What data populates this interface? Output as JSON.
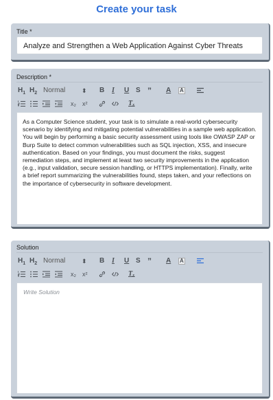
{
  "page": {
    "title": "Create your task"
  },
  "title_field": {
    "label": "Title *",
    "value": "Analyze and Strengthen a Web Application Against Cyber Threats"
  },
  "description": {
    "label": "Description *",
    "text": "As a Computer Science student, your task is to simulate a real-world cybersecurity scenario by identifying and mitigating potential vulnerabilities in a sample web application. You will begin by performing a basic security assessment using tools like OWASP ZAP or Burp Suite to detect common vulnerabilities such as SQL injection, XSS, and insecure authentication. Based on your findings, you must document the risks, suggest remediation steps, and implement at least two security improvements in the application (e.g., input validation, secure session handling, or HTTPS implementation). Finally, write a brief report summarizing the vulnerabilities found, steps taken, and your reflections on the importance of cybersecurity in software development."
  },
  "solution": {
    "label": "Solution",
    "placeholder": "Write Solution"
  },
  "toolbar": {
    "header_select": "Normal",
    "select_arrow": "⬍",
    "h1": "H",
    "h1_sub": "1",
    "h2": "H",
    "h2_sub": "2",
    "bold": "B",
    "italic": "I",
    "underline": "U",
    "strike": "S",
    "quote": "”",
    "color": "A",
    "background": "A",
    "subscript": "x₂",
    "superscript": "x²",
    "clean": "Tₓ"
  },
  "colors": {
    "accent": "#2f6fd8",
    "card_bg": "#c9d1db"
  }
}
